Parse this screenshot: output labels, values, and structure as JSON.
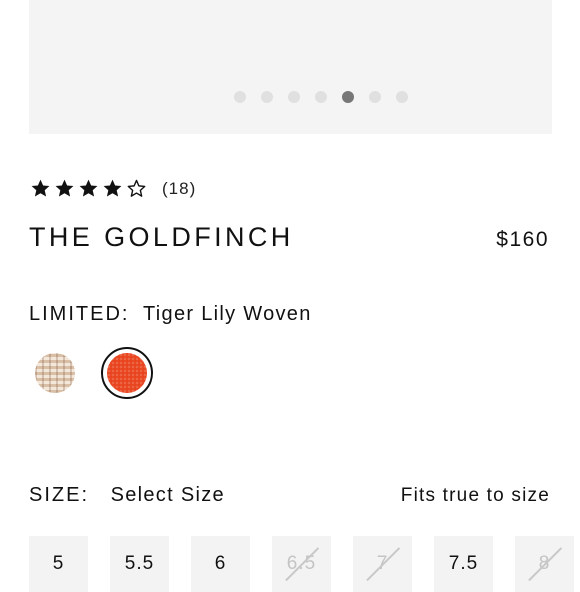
{
  "gallery": {
    "dot_count": 7,
    "active_index": 4
  },
  "rating": {
    "value": 4,
    "max": 5,
    "count_label": "(18)"
  },
  "product": {
    "title": "THE GOLDFINCH",
    "price": "$160"
  },
  "color": {
    "label": "LIMITED:",
    "selected": "Tiger Lily Woven",
    "swatches": [
      {
        "name": "natural-woven",
        "hex": "#e8d6c2"
      },
      {
        "name": "tiger-lily-woven",
        "hex": "#e8441d",
        "selected": true
      }
    ]
  },
  "size": {
    "label": "SIZE:",
    "selected": "Select Size",
    "fit_note": "Fits true to size",
    "options": [
      {
        "label": "5",
        "available": true
      },
      {
        "label": "5.5",
        "available": true
      },
      {
        "label": "6",
        "available": true
      },
      {
        "label": "6.5",
        "available": false
      },
      {
        "label": "7",
        "available": false
      },
      {
        "label": "7.5",
        "available": true
      },
      {
        "label": "8",
        "available": false
      }
    ]
  }
}
